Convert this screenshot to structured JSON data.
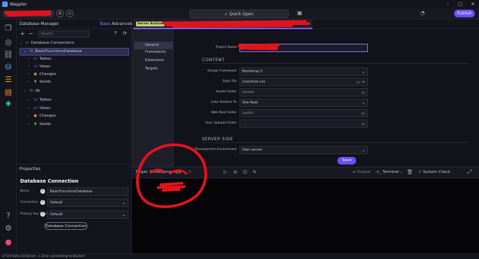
{
  "app": {
    "title": "Wappler",
    "version": "v7.0.0-beta.14"
  },
  "topbar": {
    "quick_open": "Quick Open",
    "publish": "Publish"
  },
  "db_manager": {
    "title": "Database Manager",
    "mode_basic": "Basic",
    "mode_advanced": "Advanced",
    "search_placeholder": "Search",
    "tree": {
      "root": "Database Connections",
      "conn1": "BasicFunctionsDatabase",
      "conn1_children": [
        "Tables",
        "Views",
        "Changes",
        "Seeds"
      ],
      "conn2": "db",
      "conn2_children": [
        "Tables",
        "Views",
        "Changes",
        "Seeds"
      ]
    }
  },
  "properties": {
    "header": "Properties",
    "section": "Database Connection",
    "rows": [
      {
        "label": "Name",
        "value": "BasicFunctionsDatabase"
      },
      {
        "label": "Convention",
        "value": "Default"
      },
      {
        "label": "Primary Key Type",
        "value": "Default"
      }
    ],
    "button": "Database Connection"
  },
  "editor": {
    "tab_badge": "Server Actions"
  },
  "settings": {
    "nav": [
      "General",
      "Frameworks",
      "Extensions",
      "Targets"
    ],
    "project_name_label": "Project Name",
    "content_heading": "CONTENT",
    "fields": [
      {
        "label": "Design Framework",
        "value": "Bootstrap 5",
        "type": "select"
      },
      {
        "label": "Style File",
        "value": "/css/style.css",
        "type": "file"
      },
      {
        "label": "Assets Folder",
        "value": "/assets",
        "type": "folder-ph"
      },
      {
        "label": "Links Relative To",
        "value": "Site Root",
        "type": "select"
      },
      {
        "label": "Web Root Folder",
        "value": "/public",
        "type": "folder-ph"
      },
      {
        "label": "User Uploads Folder",
        "value": "",
        "type": "folder"
      }
    ],
    "server_heading": "SERVER SIDE",
    "dev_env_label": "Development Environment",
    "dev_env_value": "Own server",
    "save": "Save"
  },
  "bottom_toolbar": {
    "target_label": "Target:",
    "target_value": "Development2",
    "output": "Output",
    "terminal": "Terminal",
    "system_check": "System Check"
  },
  "statusbar": {
    "server": "Server:",
    "message": "Error connecting to Docker!"
  },
  "colors": {
    "accent": "#6b4dff",
    "warning": "#f5c04a",
    "annotation": "#e0141e"
  }
}
